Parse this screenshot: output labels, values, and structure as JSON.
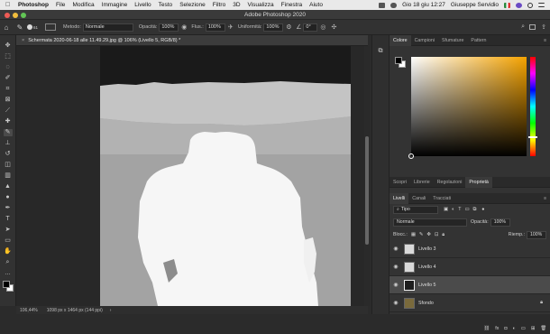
{
  "menubar": {
    "items": [
      "Photoshop",
      "File",
      "Modifica",
      "Immagine",
      "Livello",
      "Testo",
      "Selezione",
      "Filtro",
      "3D",
      "Visualizza",
      "Finestra",
      "Aiuto"
    ],
    "clock": "Gio 18 giu 12:27",
    "user": "Giuseppe Servidio"
  },
  "titlebar": {
    "title": "Adobe Photoshop 2020"
  },
  "options": {
    "metodo_label": "Metodo:",
    "metodo_value": "Normale",
    "opacita_label": "Opacità:",
    "opacita_value": "100%",
    "flusso_label": "Flus.:",
    "flusso_value": "100%",
    "uniformita_label": "Uniformità:",
    "uniformita_value": "100%",
    "angle_value": "0°",
    "brush_size": "61"
  },
  "document": {
    "tab_title": "Schermata 2020-06-18 alle 11.49.29.jpg @ 106% (Livello 5, RGB/8) *",
    "zoom": "106,44%",
    "size_info": "1098 px x 1464 px (144 ppi)"
  },
  "panels": {
    "color_tabs": [
      "Colore",
      "Campioni",
      "Sfumature",
      "Pattern"
    ],
    "mid_tabs": [
      "Scopri",
      "Librerie",
      "Regolazioni",
      "Proprietà"
    ],
    "layer_tabs": [
      "Livelli",
      "Canali",
      "Tracciati"
    ],
    "filter_placeholder": "Tipo",
    "blend_mode": "Normale",
    "opacity_label": "Opacità:",
    "opacity_value": "100%",
    "lock_label": "Blocc.:",
    "fill_label": "Riemp.:",
    "fill_value": "100%",
    "layers": [
      {
        "name": "Livello 3"
      },
      {
        "name": "Livello 4"
      },
      {
        "name": "Livello 5"
      },
      {
        "name": "Sfondo"
      }
    ]
  },
  "colors": {
    "hue": "#f5a300",
    "fg": "#000000",
    "bg": "#ffffff"
  }
}
